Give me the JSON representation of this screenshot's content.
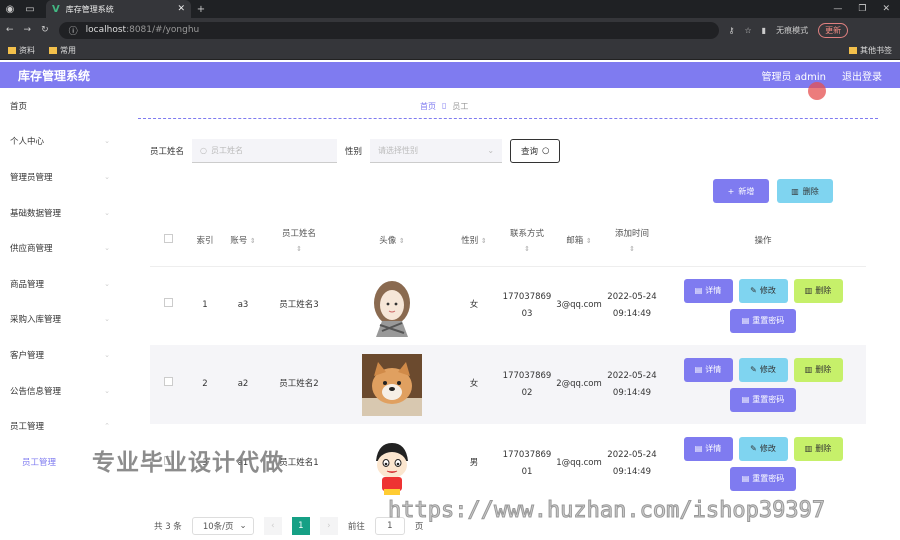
{
  "browser": {
    "tab_title": "库存管理系统",
    "url_host": "localhost",
    "url_path": ":8081/#/yonghu",
    "incognito": "无痕模式",
    "update": "更新",
    "bookmarks": [
      "资料",
      "常用"
    ],
    "bookmarks_right": "其他书签"
  },
  "header": {
    "title": "库存管理系统",
    "user": "管理员 admin",
    "logout": "退出登录"
  },
  "sidebar": {
    "items": [
      {
        "label": "首页"
      },
      {
        "label": "个人中心"
      },
      {
        "label": "管理员管理"
      },
      {
        "label": "基础数据管理"
      },
      {
        "label": "供应商管理"
      },
      {
        "label": "商品管理"
      },
      {
        "label": "采购入库管理"
      },
      {
        "label": "客户管理"
      },
      {
        "label": "公告信息管理"
      },
      {
        "label": "员工管理"
      },
      {
        "label": "员工管理"
      }
    ]
  },
  "breadcrumb": {
    "home": "首页",
    "current": "员工"
  },
  "filter": {
    "name_label": "员工姓名",
    "name_placeholder": "员工姓名",
    "gender_label": "性别",
    "gender_placeholder": "请选择性别",
    "query": "查询"
  },
  "actions": {
    "add": "新增",
    "delete": "删除"
  },
  "table": {
    "headers": [
      "索引",
      "账号",
      "员工姓名",
      "头像",
      "性别",
      "联系方式",
      "邮箱",
      "添加时间",
      "操作"
    ],
    "rows": [
      {
        "index": "1",
        "account": "a3",
        "name": "员工姓名3",
        "gender": "女",
        "phone": "17703786903",
        "email": "3@qq.com",
        "time": "2022-05-24 09:14:49"
      },
      {
        "index": "2",
        "account": "a2",
        "name": "员工姓名2",
        "gender": "女",
        "phone": "17703786902",
        "email": "2@qq.com",
        "time": "2022-05-24 09:14:49"
      },
      {
        "index": "3",
        "account": "a1",
        "name": "员工姓名1",
        "gender": "男",
        "phone": "17703786901",
        "email": "1@qq.com",
        "time": "2022-05-24 09:14:49"
      }
    ],
    "ops": {
      "detail": "详情",
      "edit": "修改",
      "remove": "删除",
      "reset": "重置密码"
    }
  },
  "pager": {
    "total": "共 3 条",
    "size": "10条/页",
    "current": "1",
    "goto": "前往",
    "goto_value": "1",
    "page_unit": "页"
  },
  "watermark": {
    "text1": "专业毕业设计代做",
    "text2": "https://www.huzhan.com/ishop39397"
  }
}
